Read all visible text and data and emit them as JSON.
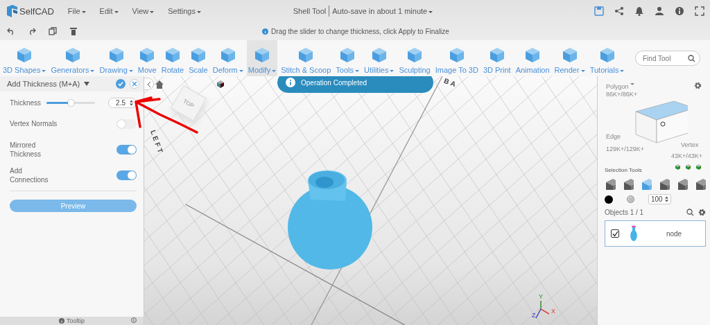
{
  "app": {
    "name": "SelfCAD"
  },
  "menu": [
    {
      "label": "File",
      "dropdown": true
    },
    {
      "label": "Edit",
      "dropdown": true
    },
    {
      "label": "View",
      "dropdown": true
    },
    {
      "label": "Settings",
      "dropdown": true
    }
  ],
  "document": {
    "tool": "Shell Tool",
    "autosave": "Auto-save in about 1 minute"
  },
  "hint": "Drag the slider to change thickness, click Apply to Finalize",
  "toolbar": [
    {
      "label": "3D Shapes",
      "dropdown": true,
      "selected": false
    },
    {
      "label": "Generators",
      "dropdown": true,
      "selected": false
    },
    {
      "label": "Drawing",
      "dropdown": true,
      "selected": false
    },
    {
      "label": "Move",
      "dropdown": false,
      "selected": false
    },
    {
      "label": "Rotate",
      "dropdown": false,
      "selected": false
    },
    {
      "label": "Scale",
      "dropdown": false,
      "selected": false
    },
    {
      "label": "Deform",
      "dropdown": true,
      "selected": false
    },
    {
      "label": "Modify",
      "dropdown": true,
      "selected": true
    },
    {
      "label": "Stitch & Scoop",
      "dropdown": false,
      "selected": false
    },
    {
      "label": "Tools",
      "dropdown": true,
      "selected": false
    },
    {
      "label": "Utilities",
      "dropdown": true,
      "selected": false
    },
    {
      "label": "Sculpting",
      "dropdown": false,
      "selected": false
    },
    {
      "label": "Image To 3D",
      "dropdown": false,
      "selected": false
    },
    {
      "label": "3D Print",
      "dropdown": false,
      "selected": false
    },
    {
      "label": "Animation",
      "dropdown": false,
      "selected": false
    },
    {
      "label": "Render",
      "dropdown": true,
      "selected": false
    },
    {
      "label": "Tutorials",
      "dropdown": true,
      "selected": false
    }
  ],
  "find_tool": {
    "placeholder": "Find Tool"
  },
  "panel": {
    "title": "Add Thickness (M+A)",
    "thickness": {
      "label": "Thickness",
      "level": 0.5,
      "value": "2.5"
    },
    "options": [
      {
        "label": "Vertex Normals",
        "on": false
      },
      {
        "label": "Mirrored Thickness",
        "on": true
      },
      {
        "label": "Add Connections",
        "on": true
      }
    ],
    "button": "Preview",
    "tooltip": "Tooltip"
  },
  "viewport": {
    "toast": "Operation Completed",
    "cube_face": "TOP",
    "labels": [
      "LEFT",
      "BA"
    ],
    "axes": [
      "Y",
      "X",
      "Z"
    ]
  },
  "mesh_info": {
    "polygon": "Polygon",
    "polygon_count": "86K+/86K+",
    "edge": "Edge",
    "edge_count": "129K+/129K+",
    "vertex": "Vertex",
    "vertex_count": "43K+/43K+"
  },
  "selection_tools": {
    "label": "Selection Tools",
    "tools": [
      {
        "selected": false
      },
      {
        "selected": false
      },
      {
        "selected": true
      },
      {
        "selected": false
      },
      {
        "selected": false
      },
      {
        "selected": false
      }
    ],
    "opacity": "100"
  },
  "objects": {
    "title": "Objects 1 / 1",
    "items": [
      {
        "name": "node",
        "checked": true
      }
    ]
  }
}
